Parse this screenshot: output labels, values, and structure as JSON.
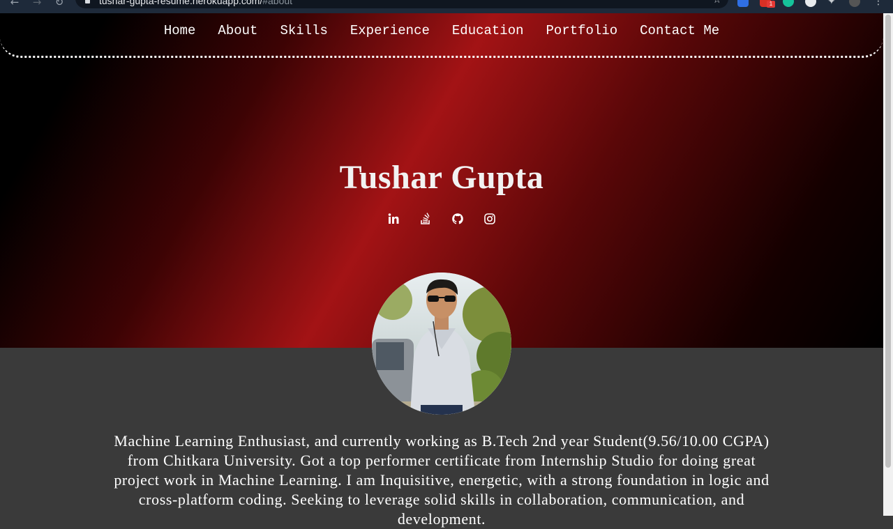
{
  "browser": {
    "url_host": "tushar-gupta-resume.herokuapp.com/",
    "url_path": "#about",
    "extension_badge": "1"
  },
  "nav": {
    "items": [
      "Home",
      "About",
      "Skills",
      "Experience",
      "Education",
      "Portfolio",
      "Contact Me"
    ]
  },
  "hero": {
    "name": "Tushar Gupta",
    "social_icons": [
      "linkedin-icon",
      "stackoverflow-icon",
      "github-icon",
      "instagram-icon"
    ]
  },
  "about": {
    "text": "Machine Learning Enthusiast, and currently working as B.Tech 2nd year Student(9.56/10.00 CGPA) from Chitkara University. Got a top performer certificate from Internship Studio for doing great project work in Machine Learning. I am Inquisitive, energetic, with a strong foundation in logic and cross-platform coding. Seeking to leverage solid skills in collaboration, communication, and development."
  },
  "colors": {
    "hero_red": "#a31315",
    "page_bg": "#3a3a3a",
    "text": "#ffffff"
  }
}
